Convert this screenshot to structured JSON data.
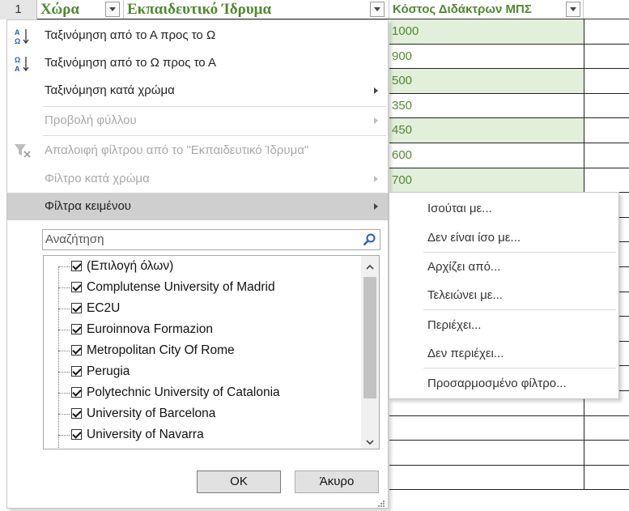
{
  "header": {
    "row_number": "1",
    "col_b": "Χώρα",
    "col_c": "Εκπαιδευτικό Ίδρυμα",
    "col_d": "Κόστος Διδάκτρων ΜΠΣ"
  },
  "cost_values": [
    "1000",
    "900",
    "500",
    "350",
    "450",
    "600",
    "700"
  ],
  "menu": {
    "sort_asc": "Ταξινόμηση από το Α προς το Ω",
    "sort_desc": "Ταξινόμηση από το Ω προς το Α",
    "sort_color": "Ταξινόμηση κατά χρώμα",
    "sheet_view": "Προβολή φύλλου",
    "clear_filter": "Απαλοιφή φίλτρου από το \"Εκπαιδευτικό Ίδρυμα\"",
    "filter_color": "Φίλτρο κατά χρώμα",
    "text_filters": "Φίλτρα κειμένου",
    "search_placeholder": "Αναζήτηση",
    "items": [
      "(Επιλογή όλων)",
      "Complutense University of Madrid",
      "EC2U",
      "Euroinnova Formazion",
      "Metropolitan City Of Rome",
      "Perugia",
      "Polytechnic University of Catalonia",
      "University of Barcelona",
      "University of Navarra"
    ],
    "ok": "OK",
    "cancel": "Άκυρο"
  },
  "submenu": {
    "equals": "Ισούται με...",
    "not_equals": "Δεν είναι ίσο με...",
    "begins_with": "Αρχίζει από...",
    "ends_with": "Τελειώνει με...",
    "contains": "Περιέχει...",
    "not_contains": "Δεν περιέχει...",
    "custom": "Προσαρμοσμένο φίλτρο..."
  },
  "colors": {
    "header_text": "#4e8a2e",
    "green_fill": "#e2efda",
    "menu_highlight": "#cfcfcf"
  }
}
